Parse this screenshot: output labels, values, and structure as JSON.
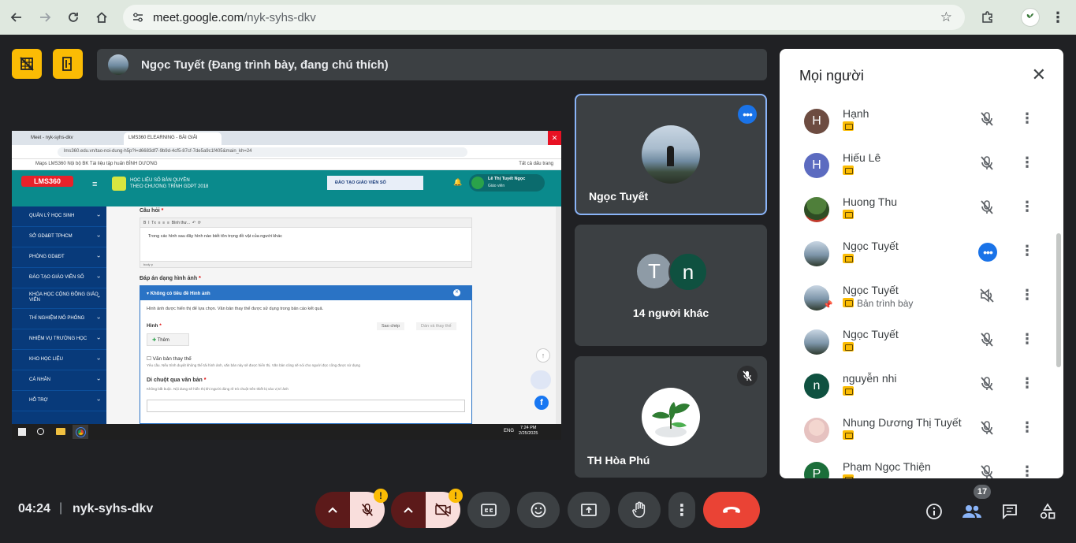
{
  "browser": {
    "url_host": "meet.google.com",
    "url_path": "/nyk-syhs-dkv"
  },
  "meet": {
    "presenter_banner": "Ngọc Tuyết (Đang trình bày, đang chú thích)",
    "time": "04:24",
    "separator": "|",
    "meeting_code": "nyk-syhs-dkv",
    "participants_badge": "17",
    "more_glyph": "•••"
  },
  "tiles": {
    "tile1_name": "Ngọc Tuyết",
    "tile2_initial_a": "T",
    "tile2_initial_b": "n",
    "tile2_label": "14 người khác",
    "tile3_name": "TH Hòa Phú"
  },
  "people_panel": {
    "title": "Mọi người",
    "rows": [
      {
        "name": "Hạnh",
        "initial": "H",
        "sub": ""
      },
      {
        "name": "Hiếu Lê",
        "initial": "H",
        "sub": ""
      },
      {
        "name": "Huong Thu",
        "initial": "",
        "sub": ""
      },
      {
        "name": "Ngọc Tuyết",
        "initial": "",
        "sub": ""
      },
      {
        "name": "Ngọc Tuyết",
        "initial": "",
        "sub": "Bản trình bày"
      },
      {
        "name": "Ngọc Tuyết",
        "initial": "",
        "sub": ""
      },
      {
        "name": "nguyễn nhi",
        "initial": "n",
        "sub": ""
      },
      {
        "name": "Nhung Dương Thị Tuyết",
        "initial": "",
        "sub": ""
      },
      {
        "name": "Phạm Ngọc Thiện",
        "initial": "P",
        "sub": ""
      }
    ]
  },
  "shared_screen": {
    "tab1": "Meet - nyk-syhs-dkv",
    "tab2": "LMS360 ELEARNING - BÀI GIẢI",
    "address": "lms360.edu.vn/tao-noi-dung-h5p?l=d6683df7-9b9d-4cf5-87cf-7de5a9c1f405&main_kh=24",
    "bookmarks": "Maps    LMS360    Nội bộ BK    Tài liệu tập huấn    BÌNH DƯƠNG",
    "bookmarks_right": "Tất cả dấu trang",
    "lms_logo": "LMS360",
    "lms_title1": "HỌC LIỆU SỐ BẢN QUYỀN",
    "lms_title2": "THEO CHƯƠNG TRÌNH GDPT 2018",
    "promo": "ĐÀO TẠO GIÁO VIÊN SỐ",
    "user_name": "Lê Thị Tuyết Ngọc",
    "user_role": "Giáo viên",
    "sidebar": [
      "QUẢN LÝ HỌC SINH",
      "SỞ GD&ĐT TPHCM",
      "PHÒNG GD&ĐT",
      "ĐÀO TẠO GIÁO VIÊN SỐ",
      "KHÓA HỌC CỘNG ĐỒNG GIÁO VIÊN",
      "THÍ NGHIỆM MÔ PHỎNG",
      "NHIỆM VỤ TRƯỜNG HỌC",
      "KHO HỌC LIỆU",
      "CÁ NHÂN",
      "HỖ TRỢ"
    ],
    "q_label": "Câu hỏi",
    "q_text": "Trong các hình sau đây hình nào biết tôn trọng đồ vật của người khác",
    "editor_tool": "Bình thư...",
    "editor_foot": "body  p",
    "ans_label": "Đáp án dạng hình ảnh",
    "ans_header": "Không có tiêu đề Hình ảnh",
    "ans_desc": "Hình ảnh được hiển thị để lựa chọn. Văn bản thay thế được sử dụng trong bản cáo kết quả.",
    "copy_btn": "Sao chép",
    "paste_btn": "Dán và thay thế",
    "img_label": "Hình",
    "add_btn": "Thêm",
    "alt_label": "Văn bản thay thế",
    "alt_desc": "Yêu cầu. Nếu trình duyệt không thể tải hình ảnh, văn bản này sẽ được hiển thị. Văn bản cũng sẽ nói cho người đọc công được sử dụng",
    "hover_label": "Di chuột qua văn bản",
    "hover_desc": "Không bắt buộc. Nội dung sẽ hiển thị khi người dùng rê trỏ chuột trên thiết bị vào vị trí ảnh",
    "tray_lang": "ENG",
    "tray_time": "7:24 PM",
    "tray_date": "2/25/2025"
  }
}
